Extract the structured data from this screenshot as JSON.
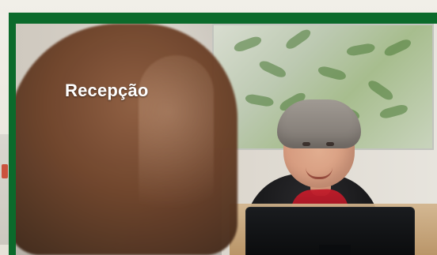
{
  "caption": {
    "title": "Recepção"
  }
}
